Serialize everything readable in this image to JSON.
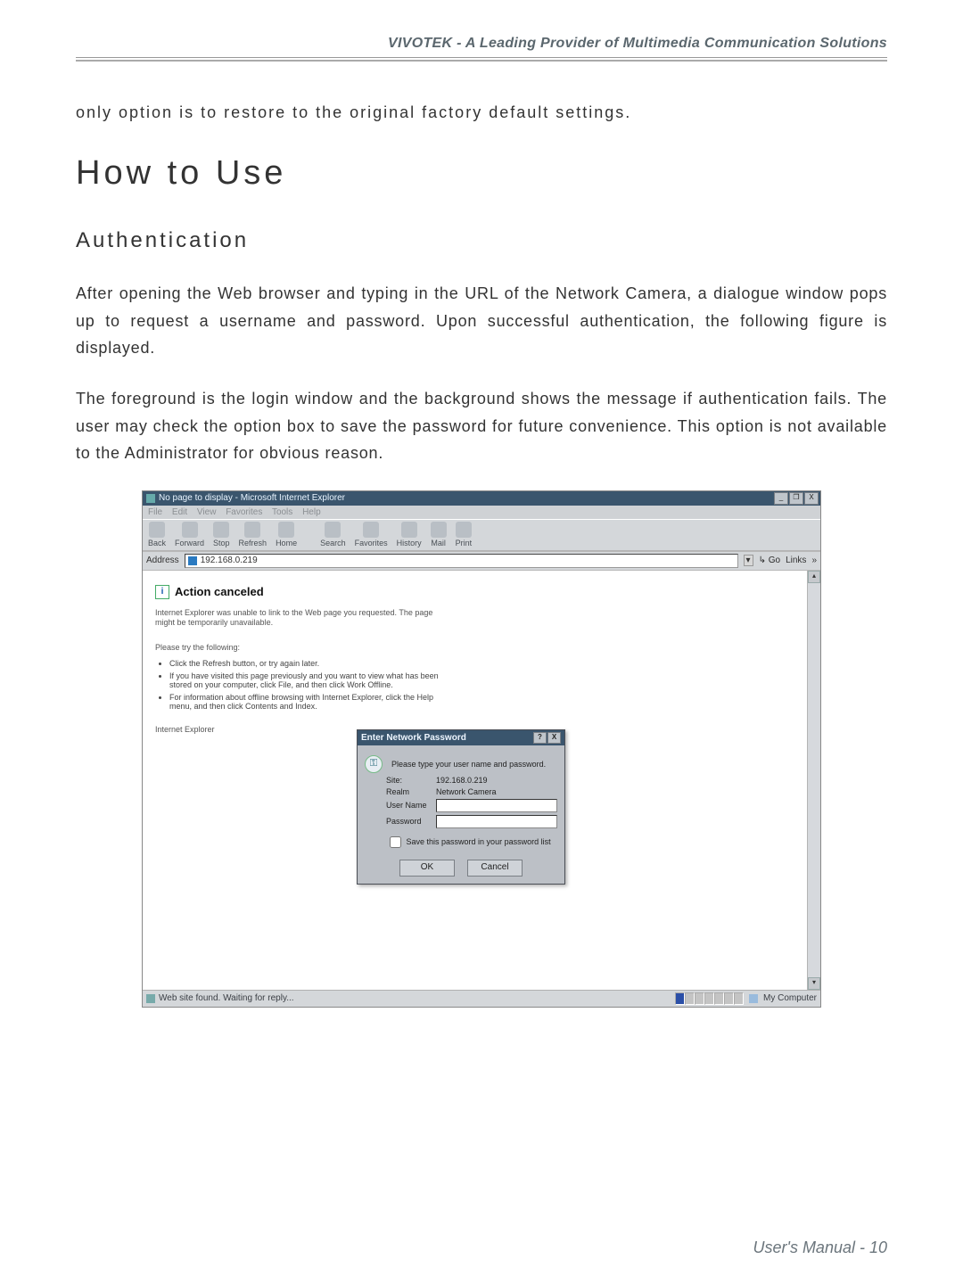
{
  "header": {
    "tagline": "VIVOTEK - A Leading Provider of Multimedia Communication Solutions"
  },
  "doc": {
    "intro_fragment": "only option is to restore to the original factory default settings.",
    "h1": "How to Use",
    "h2": "Authentication",
    "p1": "After opening the Web browser and typing in the URL of the Network Camera, a dialogue window pops up to request a username and password. Upon successful authentication, the following figure is displayed.",
    "p2": "The foreground is the login window and the background shows the message if authentication fails. The user may check the option box to save the password for future convenience.  This option is not available to the Administrator for obvious reason."
  },
  "ie": {
    "title": "No page to display - Microsoft Internet Explorer",
    "window_buttons": {
      "min": "_",
      "max": "❐",
      "close": "X"
    },
    "menubar": [
      "File",
      "Edit",
      "View",
      "Favorites",
      "Tools",
      "Help"
    ],
    "toolbar": [
      {
        "label": "Back"
      },
      {
        "label": "Forward"
      },
      {
        "label": "Stop"
      },
      {
        "label": "Refresh"
      },
      {
        "label": "Home"
      },
      {
        "label": "Search"
      },
      {
        "label": "Favorites"
      },
      {
        "label": "History"
      },
      {
        "label": "Mail"
      },
      {
        "label": "Print"
      }
    ],
    "address_label": "Address",
    "address_value": "192.168.0.219",
    "go_label": "Go",
    "links_label": "Links",
    "content": {
      "heading": "Action canceled",
      "sub": "Internet Explorer was unable to link to the Web page you requested. The page might be temporarily unavailable.",
      "try_label": "Please try the following:",
      "bullets": [
        "Click the Refresh button, or try again later.",
        "If you have visited this page previously and you want to view what has been stored on your computer, click File, and then click Work Offline.",
        "For information about offline browsing with Internet Explorer, click the Help menu, and then click Contents and Index."
      ],
      "sig": "Internet Explorer"
    },
    "statusbar": {
      "left": "Web site found. Waiting for reply...",
      "right": "My Computer"
    }
  },
  "auth": {
    "title": "Enter Network Password",
    "prompt": "Please type your user name and password.",
    "rows": {
      "site_label": "Site:",
      "site_value": "192.168.0.219",
      "realm_label": "Realm",
      "realm_value": "Network Camera",
      "user_label": "User Name",
      "pass_label": "Password"
    },
    "save_label": "Save this password in your password list",
    "ok": "OK",
    "cancel": "Cancel"
  },
  "footer": {
    "text": "User's Manual - 10"
  }
}
